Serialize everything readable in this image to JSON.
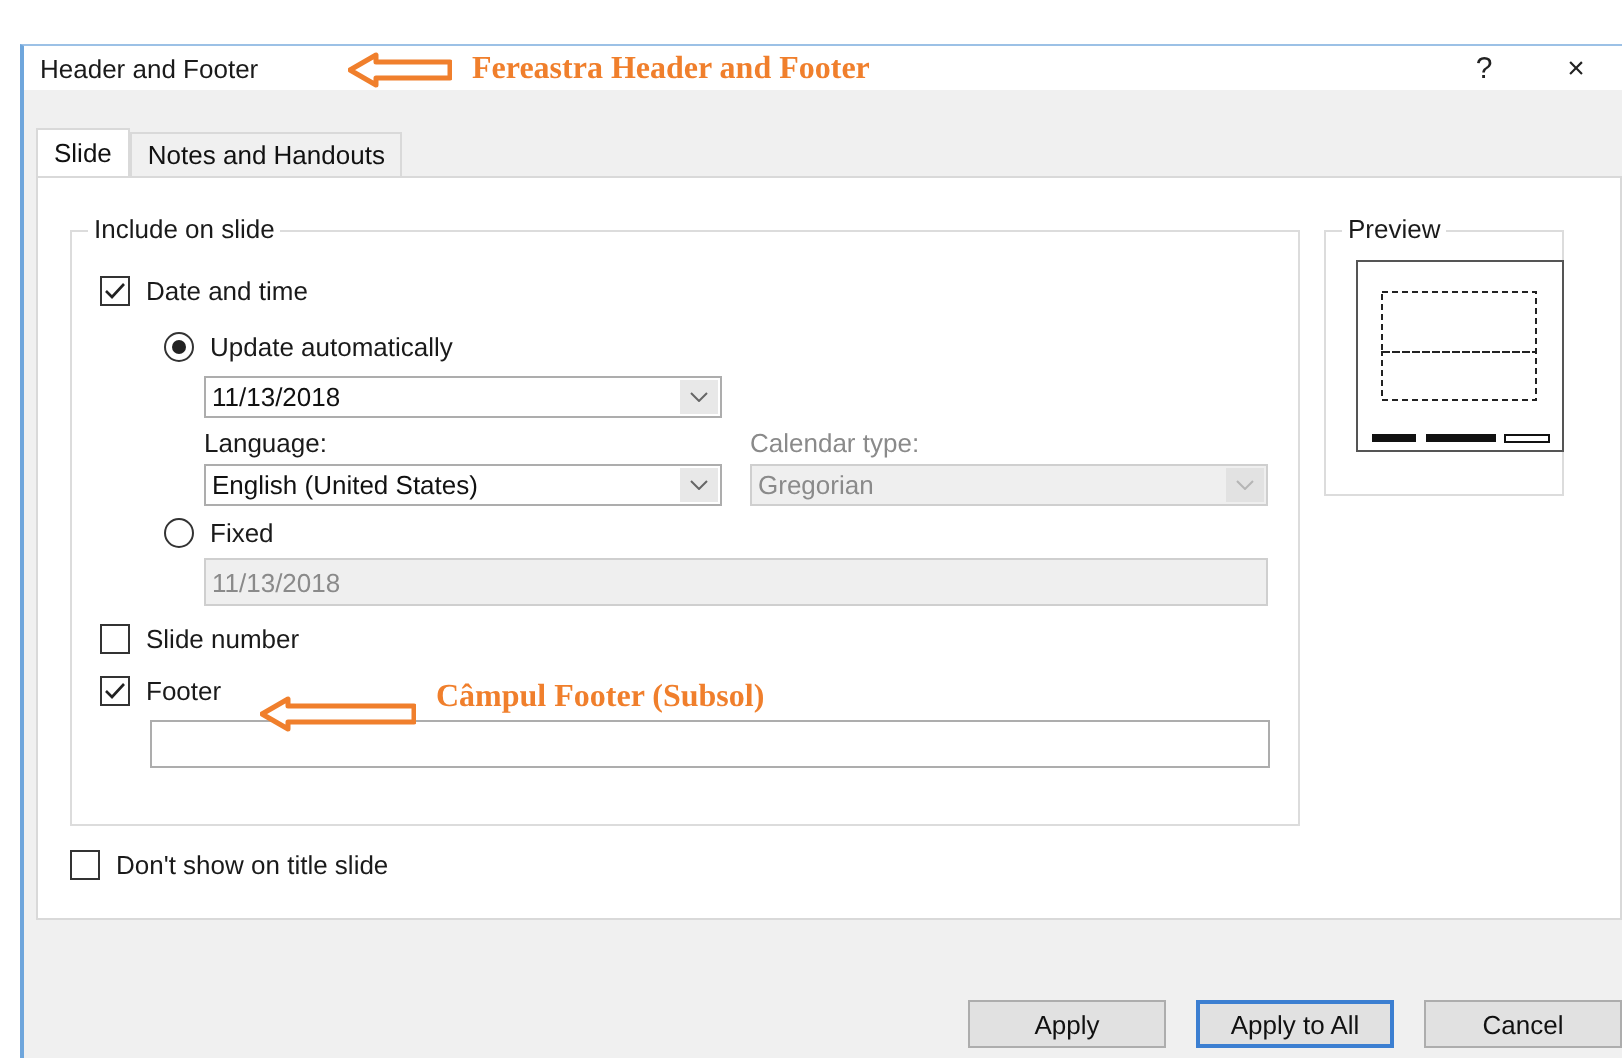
{
  "window": {
    "title": "Header and Footer",
    "help": "?",
    "close": "×",
    "annotation": "Fereastra Header and Footer"
  },
  "tabs": [
    {
      "label": "Slide",
      "selected": true
    },
    {
      "label": "Notes and Handouts",
      "selected": false
    }
  ],
  "include_group": {
    "legend": "Include on slide",
    "date_time": {
      "label": "Date and time",
      "checked": true
    },
    "update_auto": {
      "label": "Update automatically",
      "selected": true,
      "value": "11/13/2018"
    },
    "language": {
      "label": "Language:",
      "value": "English (United States)"
    },
    "calendar": {
      "label": "Calendar type:",
      "value": "Gregorian",
      "disabled": true
    },
    "fixed": {
      "label": "Fixed",
      "selected": false,
      "value": "11/13/2018",
      "disabled": true
    },
    "slide_number": {
      "label": "Slide number",
      "checked": false
    },
    "footer": {
      "label": "Footer",
      "checked": true,
      "annotation": "Câmpul Footer (Subsol)"
    }
  },
  "preview": {
    "legend": "Preview"
  },
  "dont_show": {
    "label": "Don't show on title slide",
    "checked": false
  },
  "buttons": [
    {
      "label": "Apply",
      "default": false
    },
    {
      "label": "Apply to All",
      "default": true
    },
    {
      "label": "Cancel",
      "default": false
    }
  ]
}
